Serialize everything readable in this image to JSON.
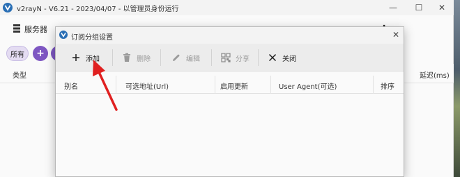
{
  "window": {
    "title": "v2rayN - V6.21 - 2023/04/07 - 以管理员身份运行",
    "min_glyph": "—",
    "max_glyph": "☐",
    "close_glyph": "✕"
  },
  "toolbar": {
    "servers_label": "服务器",
    "more_glyph": "⋮"
  },
  "filter": {
    "all_label": "所有",
    "add_glyph": "+"
  },
  "list": {
    "columns": {
      "type": "类型",
      "delay": "延迟(ms)"
    }
  },
  "dialog": {
    "title": "订阅分组设置",
    "close_glyph": "✕",
    "buttons": {
      "add": "添加",
      "delete": "删除",
      "edit": "编辑",
      "share": "分享",
      "close": "关闭"
    },
    "columns": {
      "alias": "别名",
      "url": "可选地址(Url)",
      "enable_update": "启用更新",
      "user_agent": "User Agent(可选)",
      "sort": "排序"
    }
  },
  "annotation": {
    "arrow_color": "#e02020"
  }
}
